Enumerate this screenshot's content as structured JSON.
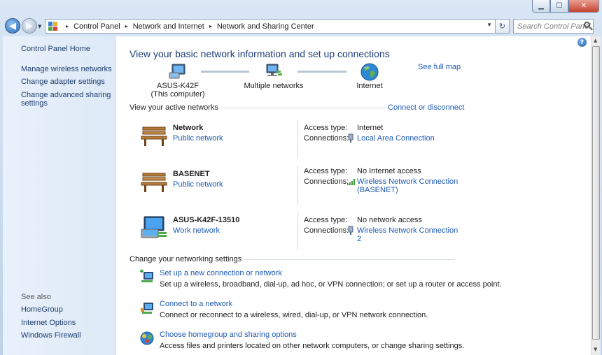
{
  "window": {
    "caption_buttons": {
      "minimize": "▁",
      "maximize": "☐",
      "close": "✕"
    }
  },
  "navbar": {
    "back_glyph": "◀",
    "forward_glyph": "▶",
    "breadcrumbs": [
      "Control Panel",
      "Network and Internet",
      "Network and Sharing Center"
    ],
    "crumb_separator": "▸",
    "refresh_glyph": "↻",
    "search_placeholder": "Search Control Panel"
  },
  "sidebar": {
    "home": "Control Panel Home",
    "tasks": [
      "Manage wireless networks",
      "Change adapter settings",
      "Change advanced sharing",
      "settings"
    ],
    "see_also_heading": "See also",
    "see_also": [
      "HomeGroup",
      "Internet Options",
      "Windows Firewall"
    ]
  },
  "main": {
    "title": "View your basic network information and set up connections",
    "see_full_map": "See full map",
    "map": [
      {
        "label": "ASUS-K42F",
        "sublabel": "(This computer)",
        "icon": "computer-icon"
      },
      {
        "label": "Multiple networks",
        "sublabel": "",
        "icon": "multiple-networks-icon"
      },
      {
        "label": "Internet",
        "sublabel": "",
        "icon": "globe-icon"
      }
    ],
    "active_networks_heading": "View your active networks",
    "connect_or_disconnect": "Connect or disconnect",
    "networks": [
      {
        "name": "Network",
        "type": "Public network",
        "icon": "bench-icon",
        "access_type_label": "Access type:",
        "access_type": "Internet",
        "connections_label": "Connections:",
        "connection": [
          "Local Area Connection"
        ],
        "connection_icon": "ethernet-plug-icon"
      },
      {
        "name": "BASENET",
        "type": "Public network",
        "icon": "bench-icon",
        "access_type_label": "Access type:",
        "access_type": "No Internet access",
        "connections_label": "Connections:",
        "connection": [
          "Wireless Network Connection",
          "(BASENET)"
        ],
        "connection_icon": "wifi-signal-icon"
      },
      {
        "name": "ASUS-K42F-13510",
        "type": "Work network",
        "icon": "work-network-icon",
        "access_type_label": "Access type:",
        "access_type": "No network access",
        "connections_label": "Connections:",
        "connection": [
          "Wireless Network Connection 2"
        ],
        "connection_icon": "ethernet-plug-icon"
      }
    ],
    "settings_heading": "Change your networking settings",
    "tasks": [
      {
        "link": "Set up a new connection or network",
        "desc": "Set up a wireless, broadband, dial-up, ad hoc, or VPN connection; or set up a router or access point.",
        "icon": "new-connection-icon"
      },
      {
        "link": "Connect to a network",
        "desc": "Connect or reconnect to a wireless, wired, dial-up, or VPN network connection.",
        "icon": "connect-network-icon"
      },
      {
        "link": "Choose homegroup and sharing options",
        "desc": "Access files and printers located on other network computers, or change sharing settings.",
        "icon": "homegroup-icon"
      }
    ]
  },
  "help_glyph": "?",
  "colors": {
    "link": "#1d59b3",
    "title": "#1e3f78",
    "sidebar": "#e3edf9"
  }
}
